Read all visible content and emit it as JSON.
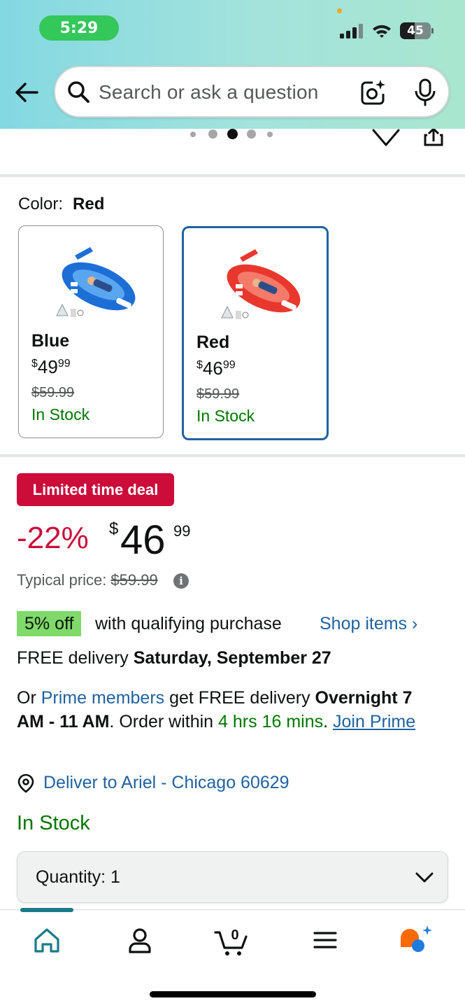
{
  "status_bar": {
    "time": "5:29",
    "battery": "45"
  },
  "search": {
    "placeholder": "Search or ask a question"
  },
  "colors": {
    "accent_link": "#2162a1",
    "deal_red": "#cc0c39",
    "stock_green": "#007600",
    "coupon_green": "#7fda69",
    "header_start": "#84d8e2",
    "header_end": "#a8e6cf"
  },
  "carousel": {
    "dot_count": 5,
    "active_dot": 3
  },
  "color_selector": {
    "label": "Color:",
    "selected": "Red",
    "options": [
      {
        "name": "Blue",
        "price_symbol": "$",
        "price_whole": "49",
        "price_cents": "99",
        "was_price": "$59.99",
        "stock": "In Stock",
        "selected": false
      },
      {
        "name": "Red",
        "price_symbol": "$",
        "price_whole": "46",
        "price_cents": "99",
        "was_price": "$59.99",
        "stock": "In Stock",
        "selected": true
      }
    ]
  },
  "deal": {
    "badge": "Limited time deal",
    "discount": "-22%",
    "price_symbol": "$",
    "price_whole": "46",
    "price_cents": "99",
    "typical_label": "Typical price:",
    "typical_price": "$59.99"
  },
  "coupon": {
    "badge": "5% off",
    "text": "with qualifying purchase",
    "link": "Shop items ›"
  },
  "delivery": {
    "prefix": "FREE delivery",
    "date": "Saturday, September 27"
  },
  "prime": {
    "or": "Or",
    "members_link": "Prime members",
    "get_text": "get FREE delivery",
    "overnight": "Overnight",
    "window": "7 AM - 11 AM",
    "order_within": ". Order within",
    "countdown": "4 hrs 16 mins",
    "period": ".",
    "join_link": "Join Prime"
  },
  "deliver_to": {
    "text": "Deliver to Ariel - Chicago 60629"
  },
  "availability": "In Stock",
  "quantity": {
    "label": "Quantity:",
    "value": "1"
  },
  "tabbar": {
    "items": [
      "home-icon",
      "account-icon",
      "cart-icon",
      "menu-icon",
      "rufus-icon"
    ],
    "active": "home-icon",
    "cart_count": "0"
  }
}
